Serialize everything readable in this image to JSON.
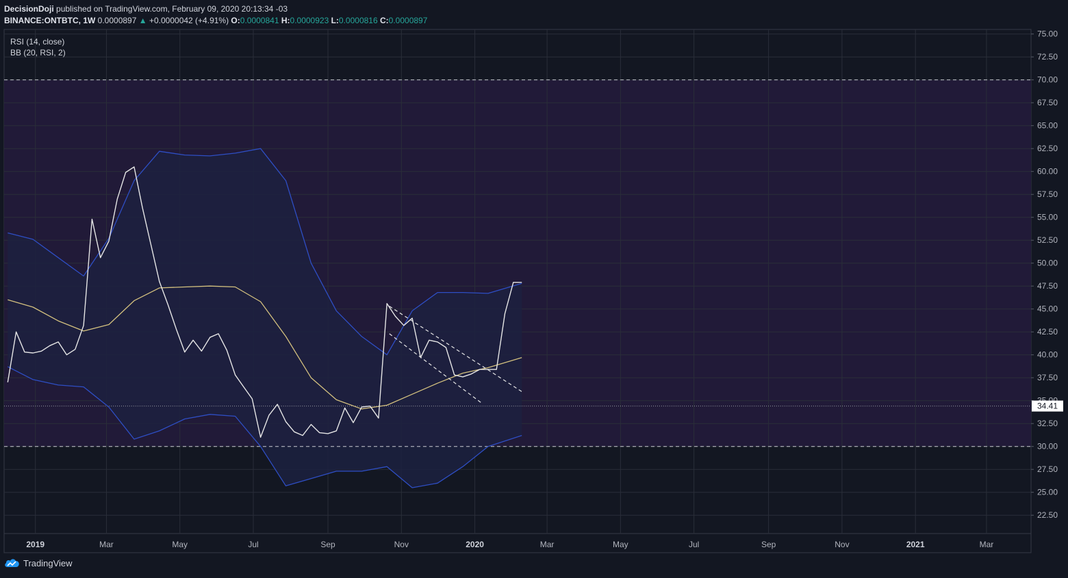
{
  "header": {
    "author": "DecisionDoji",
    "published_text": "published on TradingView.com, February 09, 2020 20:13:34 -03",
    "symbol": "BINANCE:ONTBTC, 1W",
    "last_price": "0.0000897",
    "change": "+0.0000042 (+4.91%)",
    "o_label": "O:",
    "o_value": "0.0000841",
    "h_label": "H:",
    "h_value": "0.0000923",
    "l_label": "L:",
    "l_value": "0.0000816",
    "c_label": "C:",
    "c_value": "0.0000897"
  },
  "indicators": {
    "rsi_label": "RSI (14, close)",
    "bb_label": "BB (20, RSI, 2)"
  },
  "branding": {
    "logo_text": "TradingView"
  },
  "colors": {
    "background": "#131722",
    "rsi_band": "#211a38",
    "rsi_line": "#e6e6e6",
    "bb_basis": "#d4c17f",
    "bb_bands": "#2e4ec4",
    "bb_fill": "#1c2140",
    "grid": "#2a2e39",
    "axis_text": "#b2b5be"
  },
  "chart_data": {
    "type": "line",
    "x_axis_labels": [
      {
        "date": "2019-01-01",
        "label": "2019",
        "bold": true
      },
      {
        "date": "2019-03-01",
        "label": "Mar",
        "bold": false
      },
      {
        "date": "2019-05-01",
        "label": "May",
        "bold": false
      },
      {
        "date": "2019-07-01",
        "label": "Jul",
        "bold": false
      },
      {
        "date": "2019-09-01",
        "label": "Sep",
        "bold": false
      },
      {
        "date": "2019-11-01",
        "label": "Nov",
        "bold": false
      },
      {
        "date": "2020-01-01",
        "label": "2020",
        "bold": true
      },
      {
        "date": "2020-03-01",
        "label": "Mar",
        "bold": false
      },
      {
        "date": "2020-05-01",
        "label": "May",
        "bold": false
      },
      {
        "date": "2020-07-01",
        "label": "Jul",
        "bold": false
      },
      {
        "date": "2020-09-01",
        "label": "Sep",
        "bold": false
      },
      {
        "date": "2020-11-01",
        "label": "Nov",
        "bold": false
      },
      {
        "date": "2021-01-01",
        "label": "2021",
        "bold": true
      },
      {
        "date": "2021-03-01",
        "label": "Mar",
        "bold": false
      }
    ],
    "x_range": [
      "2018-12-06",
      "2021-04-07"
    ],
    "y_range": [
      20.5,
      75.5
    ],
    "y_ticks": [
      "22.50",
      "25.00",
      "27.50",
      "30.00",
      "32.50",
      "35.00",
      "37.50",
      "40.00",
      "42.50",
      "45.00",
      "47.50",
      "50.00",
      "52.50",
      "55.00",
      "57.50",
      "60.00",
      "62.50",
      "65.00",
      "67.50",
      "70.00",
      "72.50",
      "75.00"
    ],
    "overbought": 70,
    "oversold": 30,
    "current_value": 34.41,
    "current_value_label": "34.41",
    "grid": true,
    "series": [
      {
        "key": "rsi",
        "x": [
          "2018-12-09",
          "2018-12-16",
          "2018-12-23",
          "2018-12-30",
          "2019-01-06",
          "2019-01-13",
          "2019-01-20",
          "2019-01-27",
          "2019-02-03",
          "2019-02-10",
          "2019-02-17",
          "2019-02-24",
          "2019-03-03",
          "2019-03-10",
          "2019-03-17",
          "2019-03-24",
          "2019-03-31",
          "2019-04-07",
          "2019-04-14",
          "2019-04-21",
          "2019-04-28",
          "2019-05-05",
          "2019-05-12",
          "2019-05-19",
          "2019-05-26",
          "2019-06-02",
          "2019-06-09",
          "2019-06-16",
          "2019-06-23",
          "2019-06-30",
          "2019-07-07",
          "2019-07-14",
          "2019-07-21",
          "2019-07-28",
          "2019-08-04",
          "2019-08-11",
          "2019-08-18",
          "2019-08-25",
          "2019-09-01",
          "2019-09-08",
          "2019-09-15",
          "2019-09-22",
          "2019-09-29",
          "2019-10-06",
          "2019-10-13",
          "2019-10-20",
          "2019-10-27",
          "2019-11-03",
          "2019-11-10",
          "2019-11-17",
          "2019-11-24",
          "2019-12-01",
          "2019-12-08",
          "2019-12-15",
          "2019-12-22",
          "2019-12-29",
          "2020-01-05",
          "2020-01-12",
          "2020-01-19",
          "2020-01-26",
          "2020-02-02",
          "2020-02-09"
        ],
        "values": [
          37.0,
          42.5,
          40.3,
          40.2,
          40.4,
          41.0,
          41.4,
          40.0,
          40.6,
          43.2,
          54.8,
          50.6,
          52.4,
          57.0,
          59.9,
          60.5,
          56.0,
          52.0,
          48.0,
          45.5,
          42.8,
          40.3,
          41.6,
          40.4,
          41.9,
          42.3,
          40.5,
          37.8,
          36.5,
          35.2,
          31.0,
          33.4,
          34.6,
          32.7,
          31.6,
          31.2,
          32.4,
          31.5,
          31.4,
          31.7,
          34.2,
          32.6,
          34.3,
          34.4,
          33.1,
          45.6,
          44.2,
          43.2,
          44.0,
          39.7,
          41.6,
          41.4,
          40.8,
          37.8,
          37.6,
          37.9,
          38.4,
          38.4,
          38.4,
          44.5,
          47.9,
          47.9
        ]
      },
      {
        "key": "bb_basis",
        "x": [
          "2018-12-09",
          "2018-12-30",
          "2019-01-20",
          "2019-02-10",
          "2019-03-03",
          "2019-03-24",
          "2019-04-14",
          "2019-05-05",
          "2019-05-26",
          "2019-06-16",
          "2019-07-07",
          "2019-07-28",
          "2019-08-18",
          "2019-09-08",
          "2019-09-29",
          "2019-10-20",
          "2019-11-10",
          "2019-12-01",
          "2019-12-22",
          "2020-01-12",
          "2020-02-09"
        ],
        "values": [
          46.0,
          45.2,
          43.7,
          42.6,
          43.3,
          45.9,
          47.3,
          47.4,
          47.5,
          47.4,
          45.8,
          42.0,
          37.5,
          35.1,
          34.1,
          34.5,
          35.7,
          36.9,
          38.0,
          38.6,
          39.7
        ]
      },
      {
        "key": "bb_upper",
        "x": [
          "2018-12-09",
          "2018-12-30",
          "2019-01-20",
          "2019-02-10",
          "2019-03-03",
          "2019-03-24",
          "2019-04-14",
          "2019-05-05",
          "2019-05-26",
          "2019-06-16",
          "2019-07-07",
          "2019-07-28",
          "2019-08-18",
          "2019-09-08",
          "2019-09-29",
          "2019-10-20",
          "2019-11-10",
          "2019-12-01",
          "2019-12-22",
          "2020-01-12",
          "2020-02-09"
        ],
        "values": [
          53.3,
          52.6,
          50.6,
          48.6,
          52.7,
          59.0,
          62.2,
          61.8,
          61.7,
          62.0,
          62.5,
          59.0,
          50.0,
          44.8,
          42.0,
          40.0,
          44.8,
          46.8,
          46.8,
          46.7,
          47.8
        ]
      },
      {
        "key": "bb_lower",
        "x": [
          "2018-12-09",
          "2018-12-30",
          "2019-01-20",
          "2019-02-10",
          "2019-03-03",
          "2019-03-24",
          "2019-04-14",
          "2019-05-05",
          "2019-05-26",
          "2019-06-16",
          "2019-07-07",
          "2019-07-28",
          "2019-08-18",
          "2019-09-08",
          "2019-09-29",
          "2019-10-20",
          "2019-11-10",
          "2019-12-01",
          "2019-12-22",
          "2020-01-12",
          "2020-02-09"
        ],
        "values": [
          38.7,
          37.3,
          36.7,
          36.5,
          34.3,
          30.8,
          31.7,
          33.0,
          33.5,
          33.3,
          30.0,
          25.7,
          26.5,
          27.3,
          27.3,
          27.8,
          25.5,
          26.0,
          27.8,
          30.0,
          31.2
        ]
      }
    ],
    "trendlines": [
      {
        "x": [
          "2019-10-22",
          "2020-02-10"
        ],
        "values": [
          45.3,
          35.9
        ]
      },
      {
        "x": [
          "2019-10-22",
          "2020-01-07"
        ],
        "values": [
          42.3,
          34.7
        ]
      }
    ]
  }
}
